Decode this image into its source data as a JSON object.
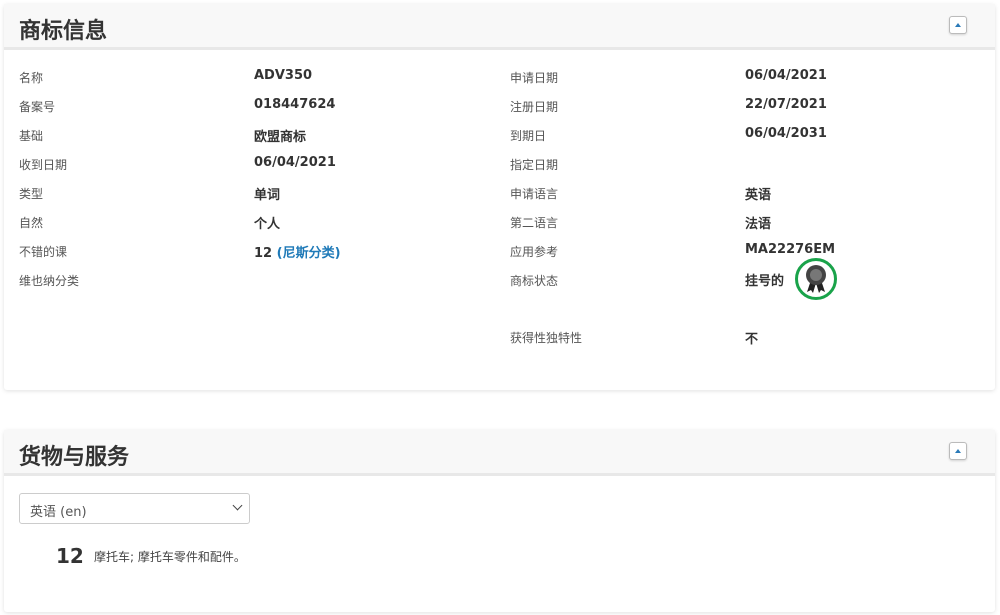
{
  "trademark_info": {
    "title": "商标信息",
    "left": [
      {
        "label": "名称",
        "value": "ADV350"
      },
      {
        "label": "备案号",
        "value": "018447624"
      },
      {
        "label": "基础",
        "value": "欧盟商标"
      },
      {
        "label": "收到日期",
        "value": "06/04/2021"
      },
      {
        "label": "类型",
        "value": "单词"
      },
      {
        "label": "自然",
        "value": "个人"
      },
      {
        "label": "不错的课",
        "value": "12",
        "link": "(尼斯分类)"
      },
      {
        "label": "维也纳分类",
        "value": ""
      }
    ],
    "right": [
      {
        "label": "申请日期",
        "value": "06/04/2021"
      },
      {
        "label": "注册日期",
        "value": "22/07/2021"
      },
      {
        "label": "到期日",
        "value": "06/04/2031"
      },
      {
        "label": "指定日期",
        "value": ""
      },
      {
        "label": "申请语言",
        "value": "英语"
      },
      {
        "label": "第二语言",
        "value": "法语"
      },
      {
        "label": "应用参考",
        "value": "MA22276EM"
      },
      {
        "label": "商标状态",
        "value": "挂号的",
        "icon": "award-ribbon-icon"
      },
      {
        "label": "获得性独特性",
        "value": "不"
      }
    ]
  },
  "goods_services": {
    "title": "货物与服务",
    "language_select": "英语 (en)",
    "items": [
      {
        "class": "12",
        "text": "摩托车; 摩托车零件和配件。"
      }
    ]
  },
  "colors": {
    "accent": "#1f7ab8",
    "status_ring": "#1aa34a"
  }
}
